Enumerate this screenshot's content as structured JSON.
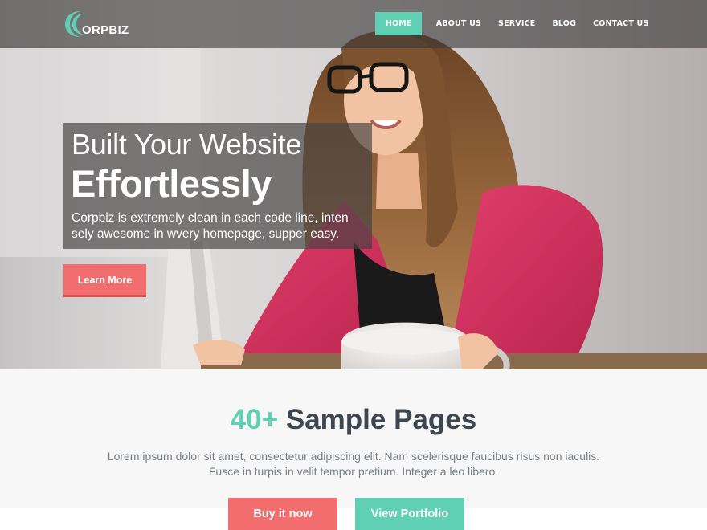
{
  "brand": {
    "name": "ORPBIZ",
    "logo_icon": "crescent-c-logo-icon",
    "accent_color": "#5fd0b3"
  },
  "nav": {
    "items": [
      "HOME",
      "ABOUT US",
      "SERVICE",
      "BLOG",
      "CONTACT US"
    ],
    "active": "HOME"
  },
  "hero": {
    "title_light": "Built Your Website",
    "title_bold": "Effortlessly",
    "subtitle_line1": "Corpbiz is extremely clean in each code line, inten",
    "subtitle_line2": "sely awesome in wvery homepage, supper easy.",
    "cta_label": "Learn More",
    "cta_color": "#f26d6d",
    "image": "woman-at-laptop-photo"
  },
  "samples": {
    "count_label": "40+",
    "title": "Sample Pages",
    "desc_line1": "Lorem ipsum dolor sit amet, consectetur adipiscing elit. Nam scelerisque faucibus risus non iaculis.",
    "desc_line2": "Fusce in turpis in velit tempor pretium. Integer a leo libero.",
    "buy_label": "Buy it now",
    "portfolio_label": "View Portfolio"
  }
}
